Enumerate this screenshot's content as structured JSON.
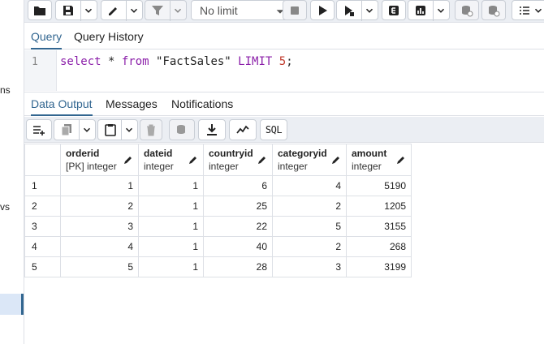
{
  "left_panel": {
    "fragment_1": "ns",
    "fragment_2": "vs"
  },
  "toolbar": {
    "limit_value": "No limit"
  },
  "query_tabs": [
    "Query",
    "Query History"
  ],
  "editor": {
    "line_number": "1",
    "code": {
      "kw_select": "select",
      "star": " * ",
      "kw_from": "from",
      "table": " \"FactSales\" ",
      "kw_limit": "LIMIT",
      "space": " ",
      "limit_num": "5",
      "semicolon": ";"
    }
  },
  "output_tabs": [
    "Data Output",
    "Messages",
    "Notifications"
  ],
  "output_toolbar": {
    "sql_label": "SQL"
  },
  "grid": {
    "columns": [
      {
        "name": "orderid",
        "type": "[PK] integer"
      },
      {
        "name": "dateid",
        "type": "integer"
      },
      {
        "name": "countryid",
        "type": "integer"
      },
      {
        "name": "categoryid",
        "type": "integer"
      },
      {
        "name": "amount",
        "type": "integer"
      }
    ],
    "rows": [
      [
        "1",
        "1",
        "1",
        "6",
        "4",
        "5190"
      ],
      [
        "2",
        "2",
        "1",
        "25",
        "2",
        "1205"
      ],
      [
        "3",
        "3",
        "1",
        "22",
        "5",
        "3155"
      ],
      [
        "4",
        "4",
        "1",
        "40",
        "2",
        "268"
      ],
      [
        "5",
        "5",
        "1",
        "28",
        "3",
        "3199"
      ]
    ]
  },
  "colors": {
    "accent": "#326690",
    "keyword": "#8b1fa9",
    "number": "#c0392b"
  }
}
